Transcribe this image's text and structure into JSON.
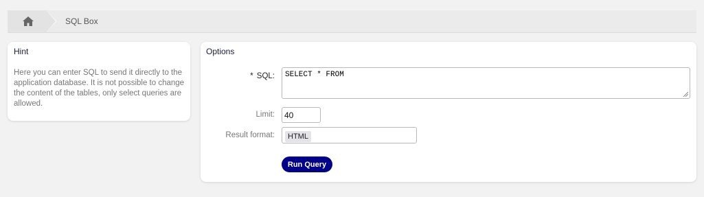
{
  "breadcrumb": {
    "home_icon": "home-icon",
    "current_label": "SQL Box"
  },
  "hint": {
    "title": "Hint",
    "text": "Here you can enter SQL to send it directly to the application database. It is not possible to change the content of the tables, only select queries are allowed."
  },
  "options": {
    "title": "Options",
    "sql_required_marker": "*",
    "sql_label": "SQL:",
    "sql_value": "SELECT * FROM",
    "limit_label": "Limit:",
    "limit_value": "40",
    "format_label": "Result format:",
    "format_value": "HTML",
    "run_button_label": "Run Query"
  },
  "colors": {
    "accent": "#00008b",
    "background": "#f2f2f2",
    "card": "#ffffff"
  }
}
